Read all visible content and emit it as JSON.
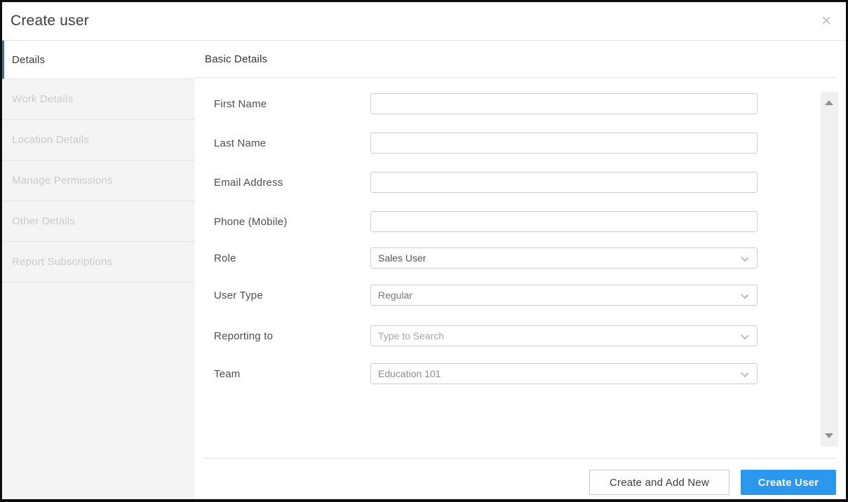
{
  "modal": {
    "title": "Create user",
    "close_glyph": "✕"
  },
  "sidebar": {
    "items": [
      {
        "label": "Details",
        "active": true
      },
      {
        "label": "Work Details",
        "active": false
      },
      {
        "label": "Location Details",
        "active": false
      },
      {
        "label": "Manage Permissions",
        "active": false
      },
      {
        "label": "Other Details",
        "active": false
      },
      {
        "label": "Report Subscriptions",
        "active": false
      }
    ]
  },
  "main": {
    "section_title": "Basic Details",
    "fields": [
      {
        "label": "First Name",
        "type": "text",
        "value": "",
        "placeholder": ""
      },
      {
        "label": "Last Name",
        "type": "text",
        "value": "",
        "placeholder": ""
      },
      {
        "label": "Email Address",
        "type": "text",
        "value": "",
        "placeholder": ""
      },
      {
        "label": "Phone (Mobile)",
        "type": "text",
        "value": "",
        "placeholder": ""
      },
      {
        "label": "Role",
        "type": "select",
        "value": "Sales User"
      },
      {
        "label": "User Type",
        "type": "select",
        "value": "Regular"
      },
      {
        "label": "Reporting to",
        "type": "select",
        "value": "",
        "placeholder": "Type to Search"
      },
      {
        "label": "Team",
        "type": "select",
        "value": "Education 101"
      }
    ],
    "icons": {
      "chevron": "chevron-down",
      "scroll_up": "triangle-up",
      "scroll_down": "triangle-down"
    },
    "footer": {
      "secondary_button": "Create and Add New",
      "primary_button": "Create User"
    }
  },
  "colors": {
    "accent_blue": "#1a7cd0",
    "primary_button_blue": "#2b97ef",
    "sidebar_bg": "#f4f4f4",
    "inactive_tab_text": "#c8cbce",
    "input_border": "#cdcdcd"
  }
}
